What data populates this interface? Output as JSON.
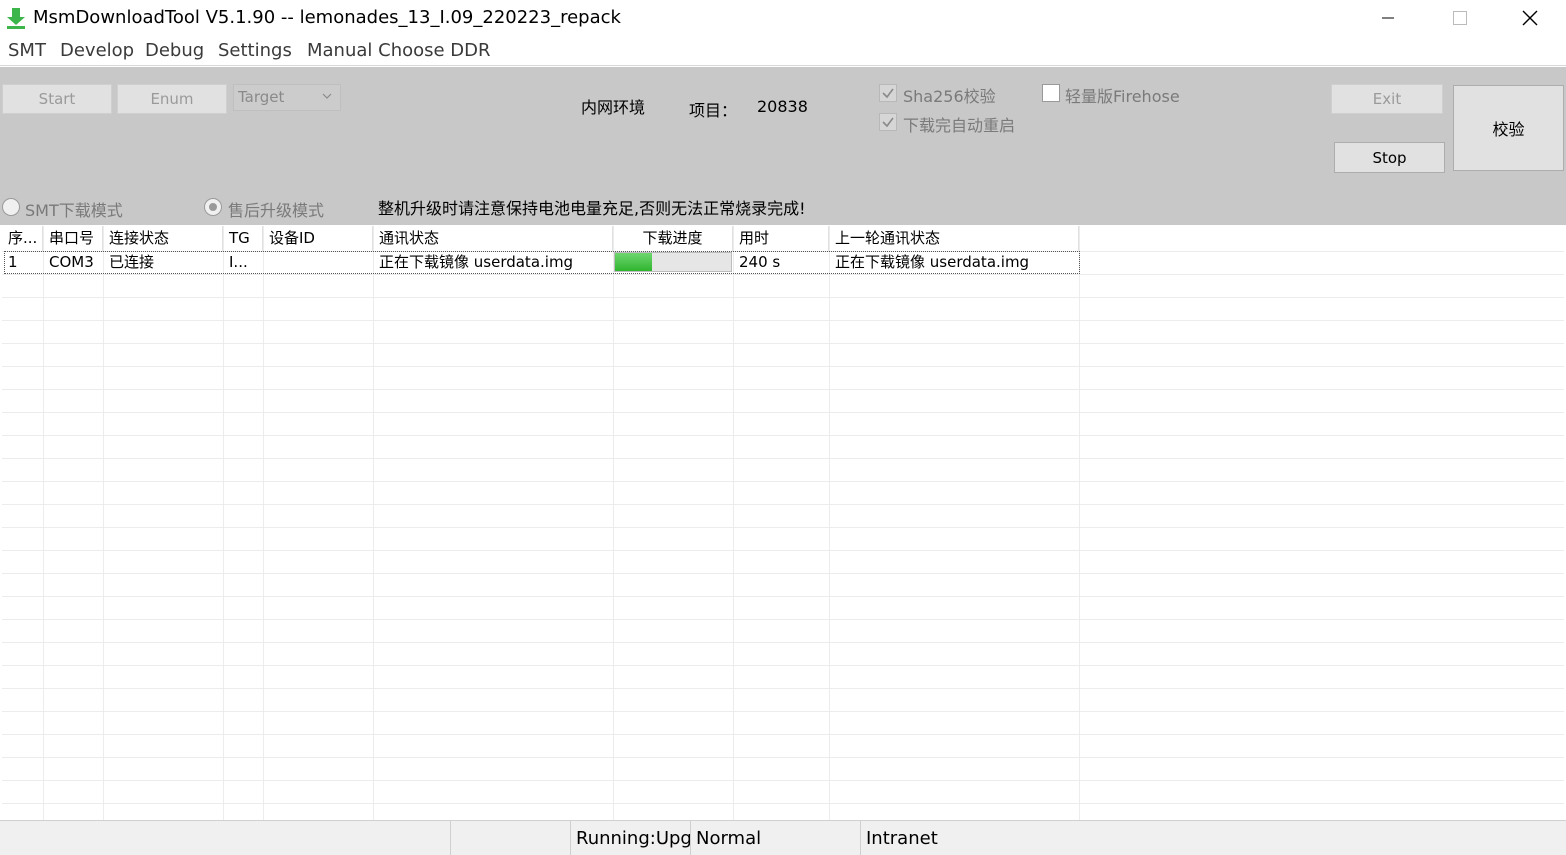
{
  "window": {
    "title": "MsmDownloadTool V5.1.90 -- lemonades_13_I.09_220223_repack",
    "minimize_icon": "minimize-icon",
    "maximize_icon": "maximize-icon",
    "close_icon": "close-icon",
    "app_icon": "download-arrow-icon",
    "app_icon_color": "#3cb64a"
  },
  "menu": {
    "items": [
      "SMT",
      "Develop",
      "Debug",
      "Settings",
      "Manual Choose DDR"
    ]
  },
  "controls": {
    "start_label": "Start",
    "enum_label": "Enum",
    "target_value": "Target",
    "env_label": "内网环境",
    "project_label": "项目：",
    "project_value": "20838",
    "sha256_label": "Sha256校验",
    "sha256_checked": true,
    "auto_reboot_label": "下载完自动重启",
    "auto_reboot_checked": true,
    "light_firehose_label": "轻量版Firehose",
    "light_firehose_checked": false,
    "exit_label": "Exit",
    "verify_label": "校验",
    "stop_label": "Stop",
    "smt_mode_label": "SMT下载模式",
    "after_sales_mode_label": "售后升级模式",
    "warning_text": "整机升级时请注意保持电池电量充足,否则无法正常烧录完成!"
  },
  "table": {
    "columns": [
      "序...",
      "串口号",
      "连接状态",
      "TG",
      "设备ID",
      "通讯状态",
      "下载进度",
      "用时",
      "上一轮通讯状态"
    ],
    "rows": [
      {
        "index": "1",
        "port": "COM3",
        "connection": "已连接",
        "tg": "I...",
        "device_id": "",
        "comm_status": "正在下载镜像 userdata.img",
        "progress": 0.32,
        "elapsed": "240 s",
        "last_comm_status": "正在下载镜像 userdata.img"
      }
    ],
    "progress_color": "#3cc43c"
  },
  "statusbar": {
    "running": "Running:Upg",
    "mode": "Normal",
    "network": "Intranet"
  }
}
